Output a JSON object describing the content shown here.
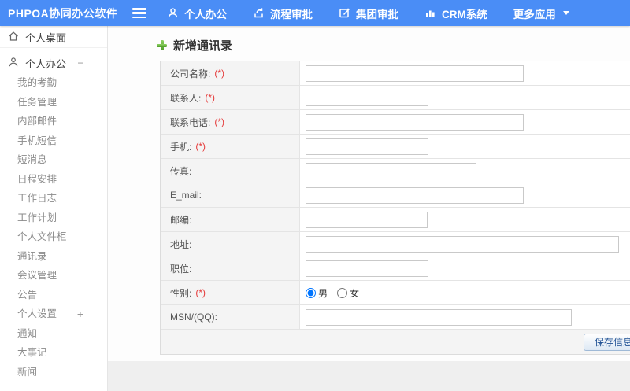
{
  "header": {
    "brand": "PHPOA协同办公软件",
    "nav": [
      {
        "name": "personal-office",
        "label": "个人办公"
      },
      {
        "name": "process-approval",
        "label": "流程审批"
      },
      {
        "name": "group-approval",
        "label": "集团审批"
      },
      {
        "name": "crm-system",
        "label": "CRM系统"
      },
      {
        "name": "more-apps",
        "label": "更多应用"
      }
    ]
  },
  "sidebar": {
    "desktop": {
      "label": "个人桌面"
    },
    "group": {
      "label": "个人办公",
      "indicator": "−"
    },
    "items": [
      {
        "name": "attendance",
        "label": "我的考勤"
      },
      {
        "name": "task-management",
        "label": "任务管理"
      },
      {
        "name": "internal-mail",
        "label": "内部邮件"
      },
      {
        "name": "mobile-sms",
        "label": "手机短信"
      },
      {
        "name": "short-message",
        "label": "短消息"
      },
      {
        "name": "schedule",
        "label": "日程安排"
      },
      {
        "name": "work-log",
        "label": "工作日志"
      },
      {
        "name": "work-plan",
        "label": "工作计划"
      },
      {
        "name": "file-cabinet",
        "label": "个人文件柜"
      },
      {
        "name": "contacts",
        "label": "通讯录"
      },
      {
        "name": "meeting-management",
        "label": "会议管理"
      },
      {
        "name": "announcement",
        "label": "公告"
      },
      {
        "name": "personal-settings",
        "label": "个人设置",
        "indicator": "+"
      },
      {
        "name": "notice",
        "label": "通知"
      },
      {
        "name": "milestones",
        "label": "大事记"
      },
      {
        "name": "news",
        "label": "新闻"
      }
    ]
  },
  "main": {
    "title": "新增通讯录",
    "form": {
      "required_mark": "(*)",
      "save_label": "保存信息",
      "gender_group": "gender",
      "rows": [
        {
          "name": "company-name",
          "label": "公司名称:",
          "required": true,
          "type": "text",
          "input_width": 277
        },
        {
          "name": "contact-person",
          "label": "联系人:",
          "required": true,
          "type": "text",
          "input_width": 156
        },
        {
          "name": "contact-phone",
          "label": "联系电话:",
          "required": true,
          "type": "text",
          "input_width": 277
        },
        {
          "name": "mobile",
          "label": "手机:",
          "required": true,
          "type": "text",
          "input_width": 156
        },
        {
          "name": "fax",
          "label": "传真:",
          "required": false,
          "type": "text",
          "input_width": 217
        },
        {
          "name": "email",
          "label": "E_mail:",
          "required": false,
          "type": "text",
          "input_width": 277
        },
        {
          "name": "zip-code",
          "label": "邮编:",
          "required": false,
          "type": "text",
          "input_width": 155
        },
        {
          "name": "address",
          "label": "地址:",
          "required": false,
          "type": "text",
          "input_width": 398
        },
        {
          "name": "position",
          "label": "职位:",
          "required": false,
          "type": "text",
          "input_width": 156
        },
        {
          "name": "gender",
          "label": "性别:",
          "required": true,
          "type": "radio",
          "options": [
            {
              "label": "男",
              "checked": true
            },
            {
              "label": "女",
              "checked": false
            }
          ]
        },
        {
          "name": "msn-qq",
          "label": "MSN/(QQ):",
          "required": false,
          "type": "text",
          "input_width": 338
        }
      ]
    }
  },
  "colors": {
    "header_blue": "#4a8df6",
    "plus_green": "#5fa932",
    "required_red": "#e53b3b",
    "button_text_blue": "#1d4f93"
  }
}
